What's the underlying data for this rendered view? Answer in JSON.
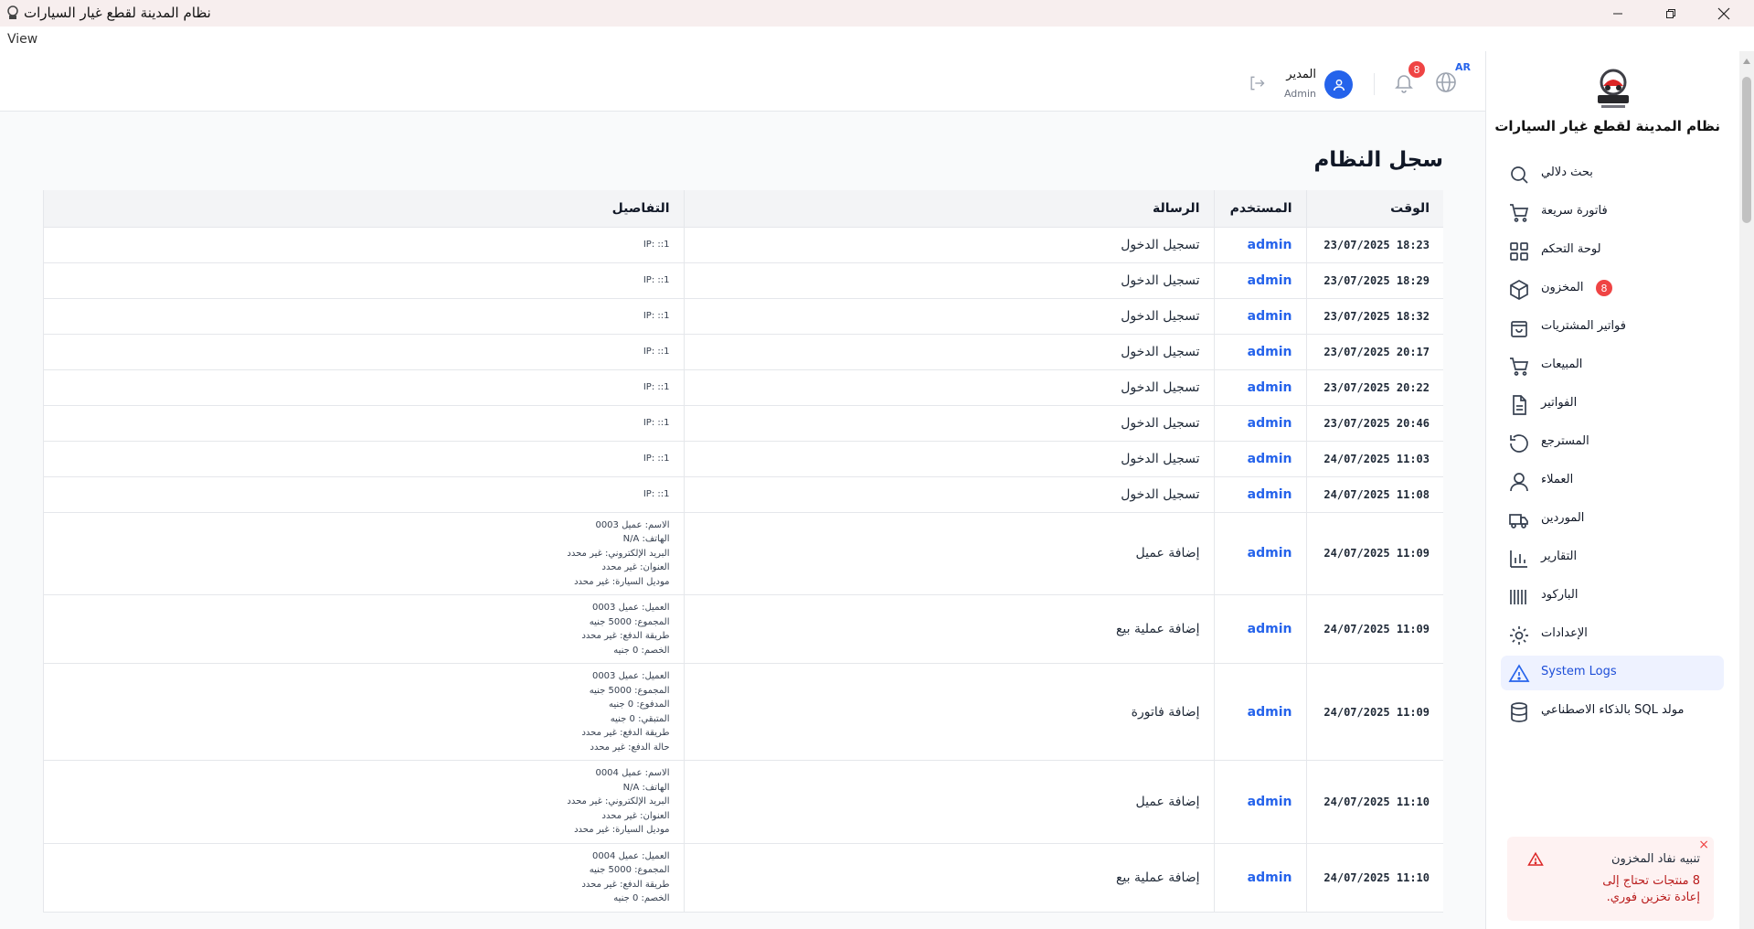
{
  "window": {
    "title": "نظام المدينة لقطع غيار السيارات",
    "menu_view": "View"
  },
  "header": {
    "lang": "AR",
    "notifications_count": "8",
    "user_name": "المدير",
    "user_role": "Admin"
  },
  "sidebar": {
    "brand": "نظام المدينة لقطع غيار السيارات",
    "items": [
      {
        "label": "بحث دلالي",
        "icon": "search-icon"
      },
      {
        "label": "فاتورة سريعة",
        "icon": "cart-icon"
      },
      {
        "label": "لوحة التحكم",
        "icon": "dashboard-icon"
      },
      {
        "label": "المخزون",
        "icon": "box-icon",
        "badge": "8"
      },
      {
        "label": "فواتير المشتريات",
        "icon": "shopping-bag-icon"
      },
      {
        "label": "المبيعات",
        "icon": "cart-icon"
      },
      {
        "label": "الفواتير",
        "icon": "document-icon"
      },
      {
        "label": "المسترجع",
        "icon": "undo-icon"
      },
      {
        "label": "العملاء",
        "icon": "user-icon"
      },
      {
        "label": "الموردين",
        "icon": "truck-icon"
      },
      {
        "label": "التقارير",
        "icon": "bar-chart-icon"
      },
      {
        "label": "الباركود",
        "icon": "barcode-icon"
      },
      {
        "label": "الإعدادات",
        "icon": "gear-icon"
      },
      {
        "label": "System Logs",
        "icon": "warning-icon",
        "active": true
      },
      {
        "label": "مولد SQL بالذكاء الاصطناعي",
        "icon": "database-icon"
      }
    ]
  },
  "page": {
    "title": "سجل النظام"
  },
  "logs": {
    "columns": {
      "time": "الوقت",
      "user": "المستخدم",
      "message": "الرسالة",
      "details": "التفاصيل"
    },
    "rows": [
      {
        "time": "23/07/2025 18:23",
        "user": "admin",
        "message": "تسجيل الدخول",
        "details": [
          "IP: ::1"
        ]
      },
      {
        "time": "23/07/2025 18:29",
        "user": "admin",
        "message": "تسجيل الدخول",
        "details": [
          "IP: ::1"
        ]
      },
      {
        "time": "23/07/2025 18:32",
        "user": "admin",
        "message": "تسجيل الدخول",
        "details": [
          "IP: ::1"
        ]
      },
      {
        "time": "23/07/2025 20:17",
        "user": "admin",
        "message": "تسجيل الدخول",
        "details": [
          "IP: ::1"
        ]
      },
      {
        "time": "23/07/2025 20:22",
        "user": "admin",
        "message": "تسجيل الدخول",
        "details": [
          "IP: ::1"
        ]
      },
      {
        "time": "23/07/2025 20:46",
        "user": "admin",
        "message": "تسجيل الدخول",
        "details": [
          "IP: ::1"
        ]
      },
      {
        "time": "24/07/2025 11:03",
        "user": "admin",
        "message": "تسجيل الدخول",
        "details": [
          "IP: ::1"
        ]
      },
      {
        "time": "24/07/2025 11:08",
        "user": "admin",
        "message": "تسجيل الدخول",
        "details": [
          "IP: ::1"
        ]
      },
      {
        "time": "24/07/2025 11:09",
        "user": "admin",
        "message": "إضافة عميل",
        "details": [
          "الاسم: عميل 0003",
          "الهاتف: N/A",
          "البريد الإلكتروني: غير محدد",
          "العنوان: غير محدد",
          "موديل السيارة: غير محدد"
        ]
      },
      {
        "time": "24/07/2025 11:09",
        "user": "admin",
        "message": "إضافة عملية بيع",
        "details": [
          "العميل: عميل 0003",
          "المجموع: 5000 جنيه",
          "طريقة الدفع: غير محدد",
          "الخصم: 0 جنيه"
        ]
      },
      {
        "time": "24/07/2025 11:09",
        "user": "admin",
        "message": "إضافة فاتورة",
        "details": [
          "العميل: عميل 0003",
          "المجموع: 5000 جنيه",
          "المدفوع: 0 جنيه",
          "المتبقي: 0 جنيه",
          "طريقة الدفع: غير محدد",
          "حالة الدفع: غير محدد"
        ]
      },
      {
        "time": "24/07/2025 11:10",
        "user": "admin",
        "message": "إضافة عميل",
        "details": [
          "الاسم: عميل 0004",
          "الهاتف: N/A",
          "البريد الإلكتروني: غير محدد",
          "العنوان: غير محدد",
          "موديل السيارة: غير محدد"
        ]
      },
      {
        "time": "24/07/2025 11:10",
        "user": "admin",
        "message": "إضافة عملية بيع",
        "details": [
          "العميل: عميل 0004",
          "المجموع: 5000 جنيه",
          "طريقة الدفع: غير محدد",
          "الخصم: 0 جنيه"
        ]
      }
    ]
  },
  "toast": {
    "title": "تنبيه نفاد المخزون",
    "body": "8 منتجات تحتاج إلى إعادة تخزين فوري.",
    "close": "×"
  },
  "colors": {
    "accent": "#2563eb",
    "danger": "#ef4444",
    "titlebar": "#f7eeee"
  }
}
